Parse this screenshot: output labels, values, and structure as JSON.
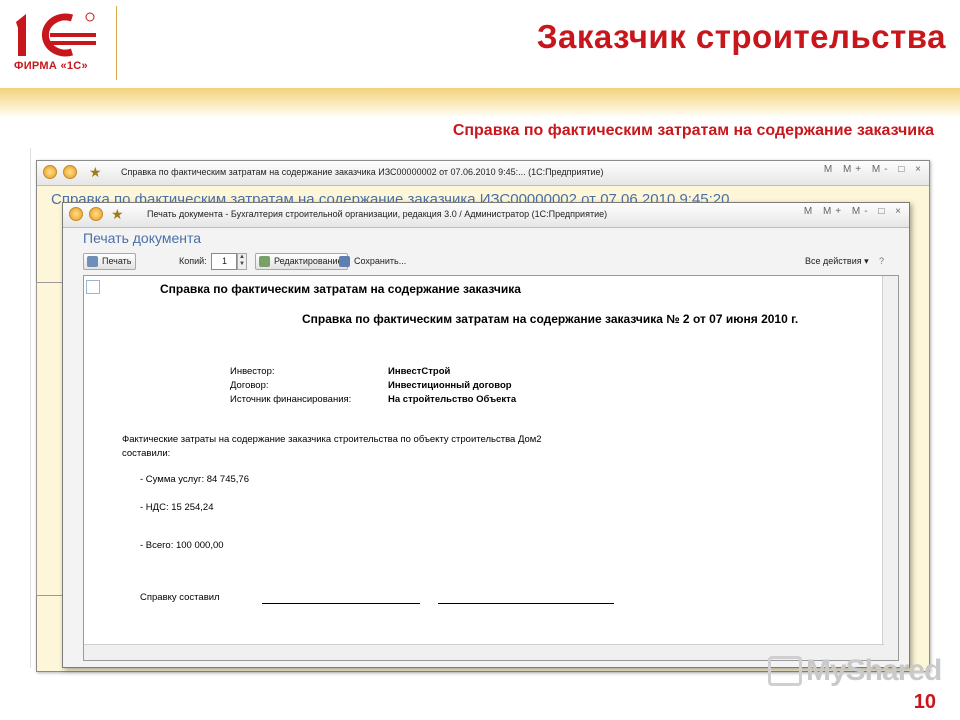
{
  "slide": {
    "title": "Заказчик строительства",
    "subtitle": "Справка по фактическим затратам на содержание заказчика",
    "page_number": "10",
    "logo_text": "ФИРМА «1С»",
    "watermark": "MyShared",
    "colors": {
      "accent": "#c8161d",
      "band": "#f2d27a",
      "window_bg": "#fdf6d8"
    }
  },
  "back_window": {
    "title": "Справка по фактическим затратам на содержание заказчика ИЗС00000002 от 07.06.2010 9:45:...  (1С:Предприятие)",
    "heading": "Справка по фактическим затратам на содержание заказчика ИЗС00000002 от 07.06.2010 9:45:20",
    "controls": "M M+ M- □ ×"
  },
  "print_window": {
    "title": "Печать документа - Бухгалтерия строительной организации, редакция 3.0 / Администратор  (1С:Предприятие)",
    "form_title": "Печать документа",
    "toolbar": {
      "print_label": "Печать",
      "copies_label": "Копий:",
      "copies_value": "1",
      "edit_label": "Редактирование",
      "save_label": "Сохранить...",
      "all_actions_label": "Все действия ▾"
    }
  },
  "document": {
    "header_short": "Справка по фактическим затратам на содержание заказчика",
    "header_full": "Справка по фактическим затратам на содержание заказчика № 2 от 07 июня 2010 г.",
    "fields": [
      {
        "label": "Инвестор:",
        "value": "ИнвестСтрой"
      },
      {
        "label": "Договор:",
        "value": "Инвестиционный договор"
      },
      {
        "label": "Источник финансирования:",
        "value": "На стройтельство Объекта"
      }
    ],
    "text_line1": "Фактические затраты на содержание заказчика строительства по объекту строительства Дом2",
    "text_line2": "составили:",
    "sum_services": "- Сумма услуг: 84 745,76",
    "vat": "- НДС: 15 254,24",
    "total": "- Всего: 100 000,00",
    "signed_by": "Справку составил"
  }
}
